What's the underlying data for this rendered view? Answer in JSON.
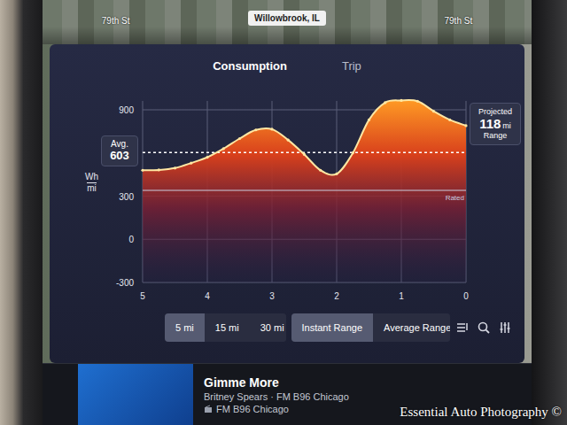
{
  "map": {
    "streets": [
      {
        "label": "79th St"
      },
      {
        "label": "79th St"
      }
    ],
    "location": "Willowbrook, IL"
  },
  "tabs": [
    {
      "label": "Consumption",
      "selected": true
    },
    {
      "label": "Trip",
      "selected": false
    }
  ],
  "chart": {
    "unit": {
      "top": "Wh",
      "bottom": "mi"
    },
    "y_ticks": [
      "900",
      "300",
      "0",
      "-300"
    ],
    "x_ticks": [
      "5",
      "4",
      "3",
      "2",
      "1",
      "0"
    ],
    "consumption": [
      480,
      482,
      495,
      530,
      570,
      630,
      700,
      760,
      765,
      690,
      590,
      480,
      455,
      600,
      830,
      950,
      965,
      960,
      890,
      830,
      790
    ],
    "average": {
      "label": "Avg.",
      "value": "603"
    },
    "rated": {
      "label": "Rated",
      "value": 340
    },
    "projected": {
      "label": "Projected",
      "value": "118",
      "unit": "mi",
      "caption": "Range"
    }
  },
  "distance_options": [
    {
      "label": "5 mi",
      "selected": true
    },
    {
      "label": "15 mi",
      "selected": false
    },
    {
      "label": "30 mi",
      "selected": false
    }
  ],
  "range_modes": [
    {
      "label": "Instant Range",
      "selected": true
    },
    {
      "label": "Average Range",
      "selected": false
    }
  ],
  "media": {
    "title": "Gimme More",
    "subtitle": "Britney Spears · FM B96 Chicago",
    "station": "FM B96 Chicago"
  },
  "watermark": "Essential Auto Photography ©"
}
